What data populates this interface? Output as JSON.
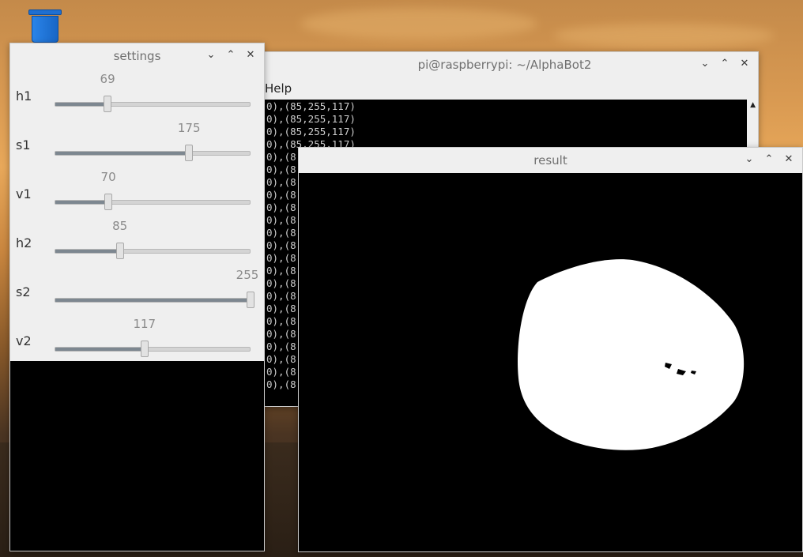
{
  "desktop": {
    "trash_icon": "trash-icon"
  },
  "terminal": {
    "title": "pi@raspberrypi: ~/AlphaBot2",
    "menu": "Help",
    "lines": [
      "0),(85,255,117)",
      "0),(85,255,117)",
      "0),(85,255,117)",
      "0),(85,255,117)",
      "0),(8",
      "0),(8",
      "0),(8",
      "0),(8",
      "0),(8",
      "0),(8",
      "0),(8",
      "0),(8",
      "0),(8",
      "0),(8",
      "0),(8",
      "0),(8",
      "0),(8",
      "0),(8",
      "0),(8",
      "0),(8",
      "0),(8",
      "0),(8",
      "0),(8"
    ]
  },
  "settings": {
    "title": "settings",
    "max": 255,
    "trackbars": [
      {
        "label": "h1",
        "value": 69
      },
      {
        "label": "s1",
        "value": 175
      },
      {
        "label": "v1",
        "value": 70
      },
      {
        "label": "h2",
        "value": 85
      },
      {
        "label": "s2",
        "value": 255
      },
      {
        "label": "v2",
        "value": 117
      }
    ]
  },
  "result": {
    "title": "result"
  },
  "window_buttons": {
    "minimize": "chevron-down-icon",
    "maximize": "chevron-up-icon",
    "close": "close-icon"
  }
}
